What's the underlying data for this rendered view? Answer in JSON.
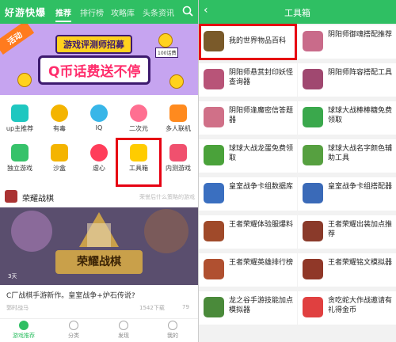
{
  "left": {
    "logo": "好游快爆",
    "tabs": [
      "推荐",
      "排行榜",
      "攻略库",
      "头条资讯"
    ],
    "banner": {
      "badge": "活动",
      "line1": "游戏评测师招募",
      "line2": "Q币话费送不停",
      "tag": "100话费"
    },
    "grid": [
      {
        "label": "up主推荐",
        "icon": "tv-icon",
        "color": "#1fc7c0"
      },
      {
        "label": "有毒",
        "icon": "skull-icon",
        "color": "#f4b400"
      },
      {
        "label": "IQ",
        "icon": "brain-icon",
        "color": "#38b6e8"
      },
      {
        "label": "二次元",
        "icon": "smile-icon",
        "color": "#ff6f91"
      },
      {
        "label": "多人联机",
        "icon": "game-icon",
        "color": "#ff8a1e"
      },
      {
        "label": "独立游戏",
        "icon": "puzzle-icon",
        "color": "#36c26a"
      },
      {
        "label": "沙盒",
        "icon": "box-icon",
        "color": "#f4b400"
      },
      {
        "label": "虐心",
        "icon": "heart-icon",
        "color": "#ff3d5a"
      },
      {
        "label": "工具箱",
        "icon": "toolbox-icon",
        "color": "#ffcc00"
      },
      {
        "label": "内测游戏",
        "icon": "beta-icon",
        "color": "#f0506e"
      }
    ],
    "section_title": "荣耀战棋",
    "section_right": "荣誉后什么策略的游戏",
    "hero_text": "荣耀战棋",
    "hero_time": "3天",
    "desc": "C厂战棋手游新作。皇室战争+炉石传说?",
    "meta": {
      "author": "郭时战马",
      "views": "1542下载",
      "likes": "79"
    },
    "bottom_nav": [
      "游戏推荐",
      "分类",
      "发现",
      "我的"
    ]
  },
  "right": {
    "title": "工具箱",
    "tools": [
      {
        "name": "我的世界物品百科",
        "color": "#7a5a2a"
      },
      {
        "name": "阴阳师御魂搭配推荐",
        "color": "#c96b8a"
      },
      {
        "name": "阴阳师悬赏封印妖怪查询器",
        "color": "#b85478"
      },
      {
        "name": "阴阳师阵容搭配工具",
        "color": "#a04870"
      },
      {
        "name": "阴阳师逢魔密信答题器",
        "color": "#d07088"
      },
      {
        "name": "球球大战棒棒糖免费领取",
        "color": "#3aa84c"
      },
      {
        "name": "球球大战龙蛋免费领取",
        "color": "#4aa23a"
      },
      {
        "name": "球球大战名字颜色辅助工具",
        "color": "#56a040"
      },
      {
        "name": "皇室战争卡组数据库",
        "color": "#3a6fc0"
      },
      {
        "name": "皇室战争卡组搭配器",
        "color": "#3a6ab8"
      },
      {
        "name": "王者荣耀体验服爆料",
        "color": "#a04a2a"
      },
      {
        "name": "王者荣耀出装加点推荐",
        "color": "#8a3a2a"
      },
      {
        "name": "王者荣耀英雄排行榜",
        "color": "#b05030"
      },
      {
        "name": "王者荣耀铭文模拟器",
        "color": "#903828"
      },
      {
        "name": "龙之谷手游技能加点模拟器",
        "color": "#4a8a3a"
      },
      {
        "name": "贪吃蛇大作战邀请有礼得金币",
        "color": "#e04040"
      }
    ]
  }
}
